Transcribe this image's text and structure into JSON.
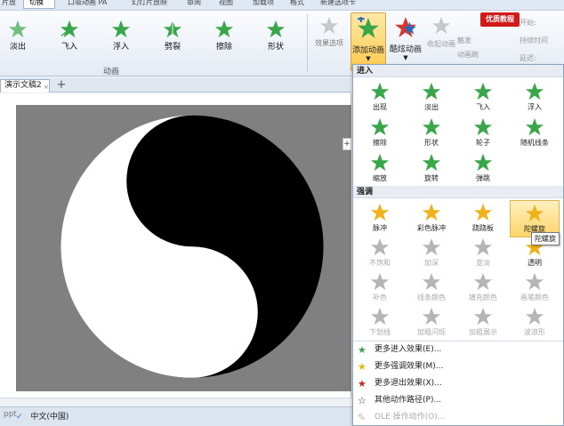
{
  "tabs": [
    "片放",
    "切换",
    "口吸动画 PA",
    "幻灯片放映",
    "审阅",
    "视图",
    "加载项",
    "格式",
    "新建选项卡"
  ],
  "ribbon": {
    "animations": [
      {
        "label": "淡出",
        "style": "fade"
      },
      {
        "label": "飞入",
        "style": "fly"
      },
      {
        "label": "浮入",
        "style": "float"
      },
      {
        "label": "劈裂",
        "style": "split"
      },
      {
        "label": "擦除",
        "style": "wipe"
      },
      {
        "label": "形状",
        "style": "shape"
      }
    ],
    "group_label": "动画",
    "effect_options": "效果选项",
    "add_animation": "添加动画",
    "animation_painter": "酷炫动画",
    "trigger": "收起动画",
    "small_cmds": [
      "开始:",
      "触发",
      "持续时间",
      "动画刷",
      "延迟:"
    ],
    "watermark": "优质教程"
  },
  "doc_tab": {
    "label": "演示文稿2",
    "close": "×",
    "new_tab": "+"
  },
  "side_plus": "+",
  "status": {
    "left": "ppt",
    "lang": "中文(中国)"
  },
  "panel": {
    "entrance_title": "进入",
    "entrance": [
      "出现",
      "淡出",
      "飞入",
      "浮入",
      "擦除",
      "形状",
      "轮子",
      "随机线条",
      "缩放",
      "旋转",
      "弹跳"
    ],
    "emphasis_title": "强调",
    "emphasis": [
      "脉冲",
      "彩色脉冲",
      "跷跷板",
      "陀螺旋",
      "不饱和",
      "加深",
      "变淡",
      "透明",
      "补色",
      "线条颜色",
      "填充颜色",
      "画笔颜色",
      "下划线",
      "加粗闪烁",
      "加粗展示",
      "波浪形"
    ],
    "selected": "陀螺旋",
    "tooltip": "陀螺旋",
    "more": [
      {
        "label": "更多进入效果(E)...",
        "icon": "green-star-icon"
      },
      {
        "label": "更多强调效果(M)...",
        "icon": "yellow-star-icon"
      },
      {
        "label": "更多退出效果(X)...",
        "icon": "red-star-icon"
      },
      {
        "label": "其他动作路径(P)...",
        "icon": "outline-star-icon"
      },
      {
        "label": "OLE 操作动作(O)...",
        "icon": "ole-icon"
      }
    ]
  },
  "colors": {
    "green": "#3aa64a",
    "gold": "#f0b21a",
    "grey": "#b5b5b5"
  }
}
